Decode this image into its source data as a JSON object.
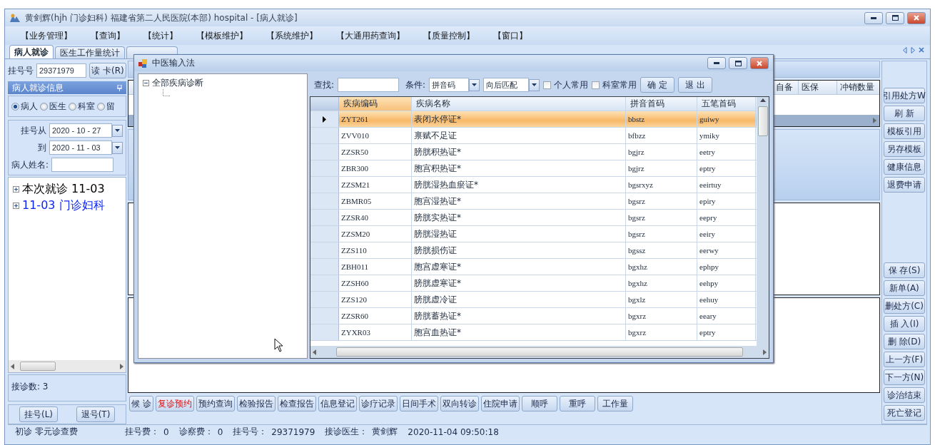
{
  "window": {
    "title": "黄剑辉(hjh 门诊妇科) 福建省第二人民医院(本部) hospital - [病人就诊]"
  },
  "menu": [
    "【业务管理】",
    "【查询】",
    "【统计】",
    "【模板维护】",
    "【系统维护】",
    "【大通用药查询】",
    "【质量控制】",
    "【窗口】"
  ],
  "tabs": [
    {
      "label": "病人就诊",
      "selected": true
    },
    {
      "label": "医生工作量统计",
      "selected": false
    },
    {
      "selected": false
    }
  ],
  "left_panel": {
    "reg_label": "挂号号",
    "reg_value": "29371979",
    "read_card_button": "读 卡(R)",
    "header": "病人就诊信息",
    "radios": [
      {
        "label": "病人",
        "selected": true
      },
      {
        "label": "医生",
        "selected": false
      },
      {
        "label": "科室",
        "selected": false
      },
      {
        "label": "留",
        "selected": false
      }
    ],
    "date_from_label": "挂号从",
    "date_from": "2020 - 10 - 27",
    "date_to_label": "到",
    "date_to": "2020 - 11 - 03",
    "name_label": "病人姓名:",
    "tree": [
      {
        "label": "本次就诊 11-03",
        "kind": "current",
        "expanded": false
      },
      {
        "label": "11-03 门诊妇科",
        "kind": "visit",
        "expanded": false
      }
    ],
    "count": "接诊数: 3",
    "buttons": [
      "挂号(L)",
      "退号(T)"
    ]
  },
  "center": {
    "grid_columns": [
      "自备",
      "医保",
      "冲销数量"
    ],
    "bottom_buttons": [
      {
        "label": "候 诊",
        "highlighted": false
      },
      {
        "label": "复诊预约",
        "highlighted": true
      },
      {
        "label": "预约查询",
        "highlighted": false
      },
      {
        "label": "检验报告",
        "highlighted": false
      },
      {
        "label": "检查报告",
        "highlighted": false
      },
      {
        "label": "信息登记",
        "highlighted": false
      },
      {
        "label": "诊疗记录",
        "highlighted": false
      },
      {
        "label": "日间手术",
        "highlighted": false
      },
      {
        "label": "双向转诊",
        "highlighted": false
      },
      {
        "label": "住院申请",
        "highlighted": false
      },
      {
        "label": "顺呼",
        "highlighted": false
      },
      {
        "label": "重呼",
        "highlighted": false
      },
      {
        "label": "工作量",
        "highlighted": false
      }
    ]
  },
  "right_buttons": {
    "top": [
      "引用处方W",
      "刷 新",
      "模板引用",
      "另存模板",
      "健康信息",
      "退费申请"
    ],
    "bottom": [
      "保 存(S)",
      "新单(A)",
      "删处方(C)",
      "插 入(I)",
      "删 除(D)",
      "上一方(F)",
      "下一方(N)",
      "诊治结束",
      "死亡登记"
    ]
  },
  "status_bar": {
    "note": "初诊 零元诊查费",
    "fields": [
      {
        "label": "挂号费：",
        "value": "0"
      },
      {
        "label": "诊察费：",
        "value": "0"
      },
      {
        "label": "挂号号：",
        "value": "29371979"
      },
      {
        "label": "接诊医生：",
        "value": "黄剑辉"
      }
    ],
    "timestamp": "2020-11-04 09:50:18"
  },
  "dialog": {
    "title": "中医输入法",
    "tree": [
      {
        "label": "全部疾病诊断",
        "expanded": true
      }
    ],
    "find_label": "查找:",
    "condition_label": "条件:",
    "condition_value": "拼音码",
    "match_value": "向后匹配",
    "checks": [
      {
        "label": "个人常用",
        "checked": false
      },
      {
        "label": "科室常用",
        "checked": false
      }
    ],
    "buttons": [
      "确 定",
      "退 出"
    ],
    "columns": [
      {
        "label": "疾病编码",
        "active": true
      },
      {
        "label": "疾病名称",
        "active": false
      },
      {
        "label": "拼音首码",
        "active": false
      },
      {
        "label": "五笔首码",
        "active": false
      }
    ],
    "rows": [
      {
        "cells": [
          "ZYT261",
          "表闭水停证*",
          "bbstz",
          "guiwy"
        ],
        "selected": true
      },
      {
        "cells": [
          "ZVV010",
          "禀赋不足证",
          "bfbzz",
          "ymiky"
        ],
        "selected": false
      },
      {
        "cells": [
          "ZZSR50",
          "膀胱积热证*",
          "bgjrz",
          "eetry"
        ],
        "selected": false
      },
      {
        "cells": [
          "ZBR300",
          "胞宫积热证*",
          "bgjrz",
          "eptry"
        ],
        "selected": false
      },
      {
        "cells": [
          "ZZSM21",
          "膀胱湿热血瘀证*",
          "bgsrxyz",
          "eeirtuy"
        ],
        "selected": false
      },
      {
        "cells": [
          "ZBMR05",
          "胞宫湿热证*",
          "bgsrz",
          "epiry"
        ],
        "selected": false
      },
      {
        "cells": [
          "ZZSR40",
          "膀胱实热证*",
          "bgsrz",
          "eepry"
        ],
        "selected": false
      },
      {
        "cells": [
          "ZZSM20",
          "膀胱湿热证",
          "bgsrz",
          "eeiry"
        ],
        "selected": false
      },
      {
        "cells": [
          "ZZS110",
          "膀胱损伤证",
          "bgssz",
          "eerwy"
        ],
        "selected": false
      },
      {
        "cells": [
          "ZBH011",
          "胞宫虚寒证*",
          "bgxhz",
          "ephpy"
        ],
        "selected": false
      },
      {
        "cells": [
          "ZZSH60",
          "膀胱虚寒证*",
          "bgxhz",
          "eehpy"
        ],
        "selected": false
      },
      {
        "cells": [
          "ZZS120",
          "膀胱虚冷证",
          "bgxlz",
          "eehuy"
        ],
        "selected": false
      },
      {
        "cells": [
          "ZZSR60",
          "膀胱蓄热证*",
          "bgxrz",
          "eeary"
        ],
        "selected": false
      },
      {
        "cells": [
          "ZYXR03",
          "胞宫血热证*",
          "bgxrz",
          "eptry"
        ],
        "selected": false
      }
    ]
  }
}
